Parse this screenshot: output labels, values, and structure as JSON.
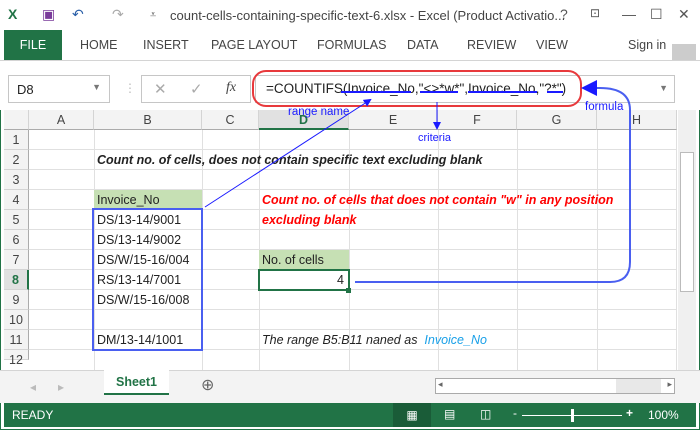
{
  "window": {
    "title": "count-cells-containing-specific-text-6.xlsx - Excel (Product Activatio...",
    "help": "?",
    "minimize": "—",
    "maximize": "☐",
    "close": "✕"
  },
  "ribbon": {
    "file": "FILE",
    "tabs": [
      "HOME",
      "INSERT",
      "PAGE LAYOUT",
      "FORMULAS",
      "DATA",
      "REVIEW",
      "VIEW"
    ],
    "signin": "Sign in"
  },
  "formula_bar": {
    "name_box": "D8",
    "cancel": "✕",
    "enter": "✓",
    "fx": "fx",
    "formula": "=COUNTIFS(Invoice_No,\"<>*w*\",Invoice_No,\"?*\")"
  },
  "columns": [
    "A",
    "B",
    "C",
    "D",
    "E",
    "F",
    "G",
    "H"
  ],
  "rows": [
    "1",
    "2",
    "3",
    "4",
    "5",
    "6",
    "7",
    "8",
    "9",
    "10",
    "11",
    "12"
  ],
  "cells": {
    "B2": "Count no. of cells, does not contain specific text excluding blank",
    "B4": "Invoice_No",
    "B5": "DS/13-14/9001",
    "B6": "DS/13-14/9002",
    "B7": "DS/W/15-16/004",
    "B8": "RS/13-14/7001",
    "B9": "DS/W/15-16/008",
    "B11": "DM/13-14/1001",
    "D4": "Count no. of cells that does not contain \"w\" in any position",
    "D5": "excluding blank",
    "D7": "No. of cells",
    "D8": "4",
    "D11": "The range B5:B11 naned as",
    "D11b": "Invoice_No"
  },
  "annotations": {
    "range_name": "range name",
    "criteria": "criteria",
    "formula": "formula"
  },
  "sheet_tabs": [
    "Sheet1"
  ],
  "status": {
    "ready": "READY",
    "zoom": "100%",
    "zoom_level": 100
  },
  "colors": {
    "excel_green": "#217346",
    "header_fill": "#c6e0b4",
    "annotation_blue": "#1a1aff",
    "red_text": "#ff0000"
  }
}
